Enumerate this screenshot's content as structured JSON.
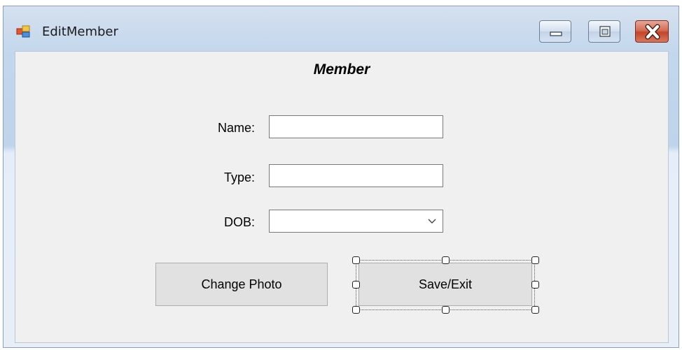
{
  "window": {
    "title": "EditMember",
    "controls": {
      "minimize": "minimize",
      "maximize": "maximize",
      "close": "close"
    }
  },
  "form": {
    "heading": "Member",
    "fields": [
      {
        "label": "Name:",
        "value": "",
        "kind": "textbox"
      },
      {
        "label": "Type:",
        "value": "",
        "kind": "textbox"
      },
      {
        "label": "DOB:",
        "value": "",
        "kind": "datepicker"
      }
    ],
    "buttons": {
      "change_photo": "Change Photo",
      "save_exit": "Save/Exit"
    }
  },
  "designer": {
    "selected_control": "Save/Exit",
    "handle_icon": "resize-handle"
  },
  "colors": {
    "client_bg": "#f0f0f0",
    "button_bg": "#e1e1e1",
    "close_red": "#c3452b"
  }
}
